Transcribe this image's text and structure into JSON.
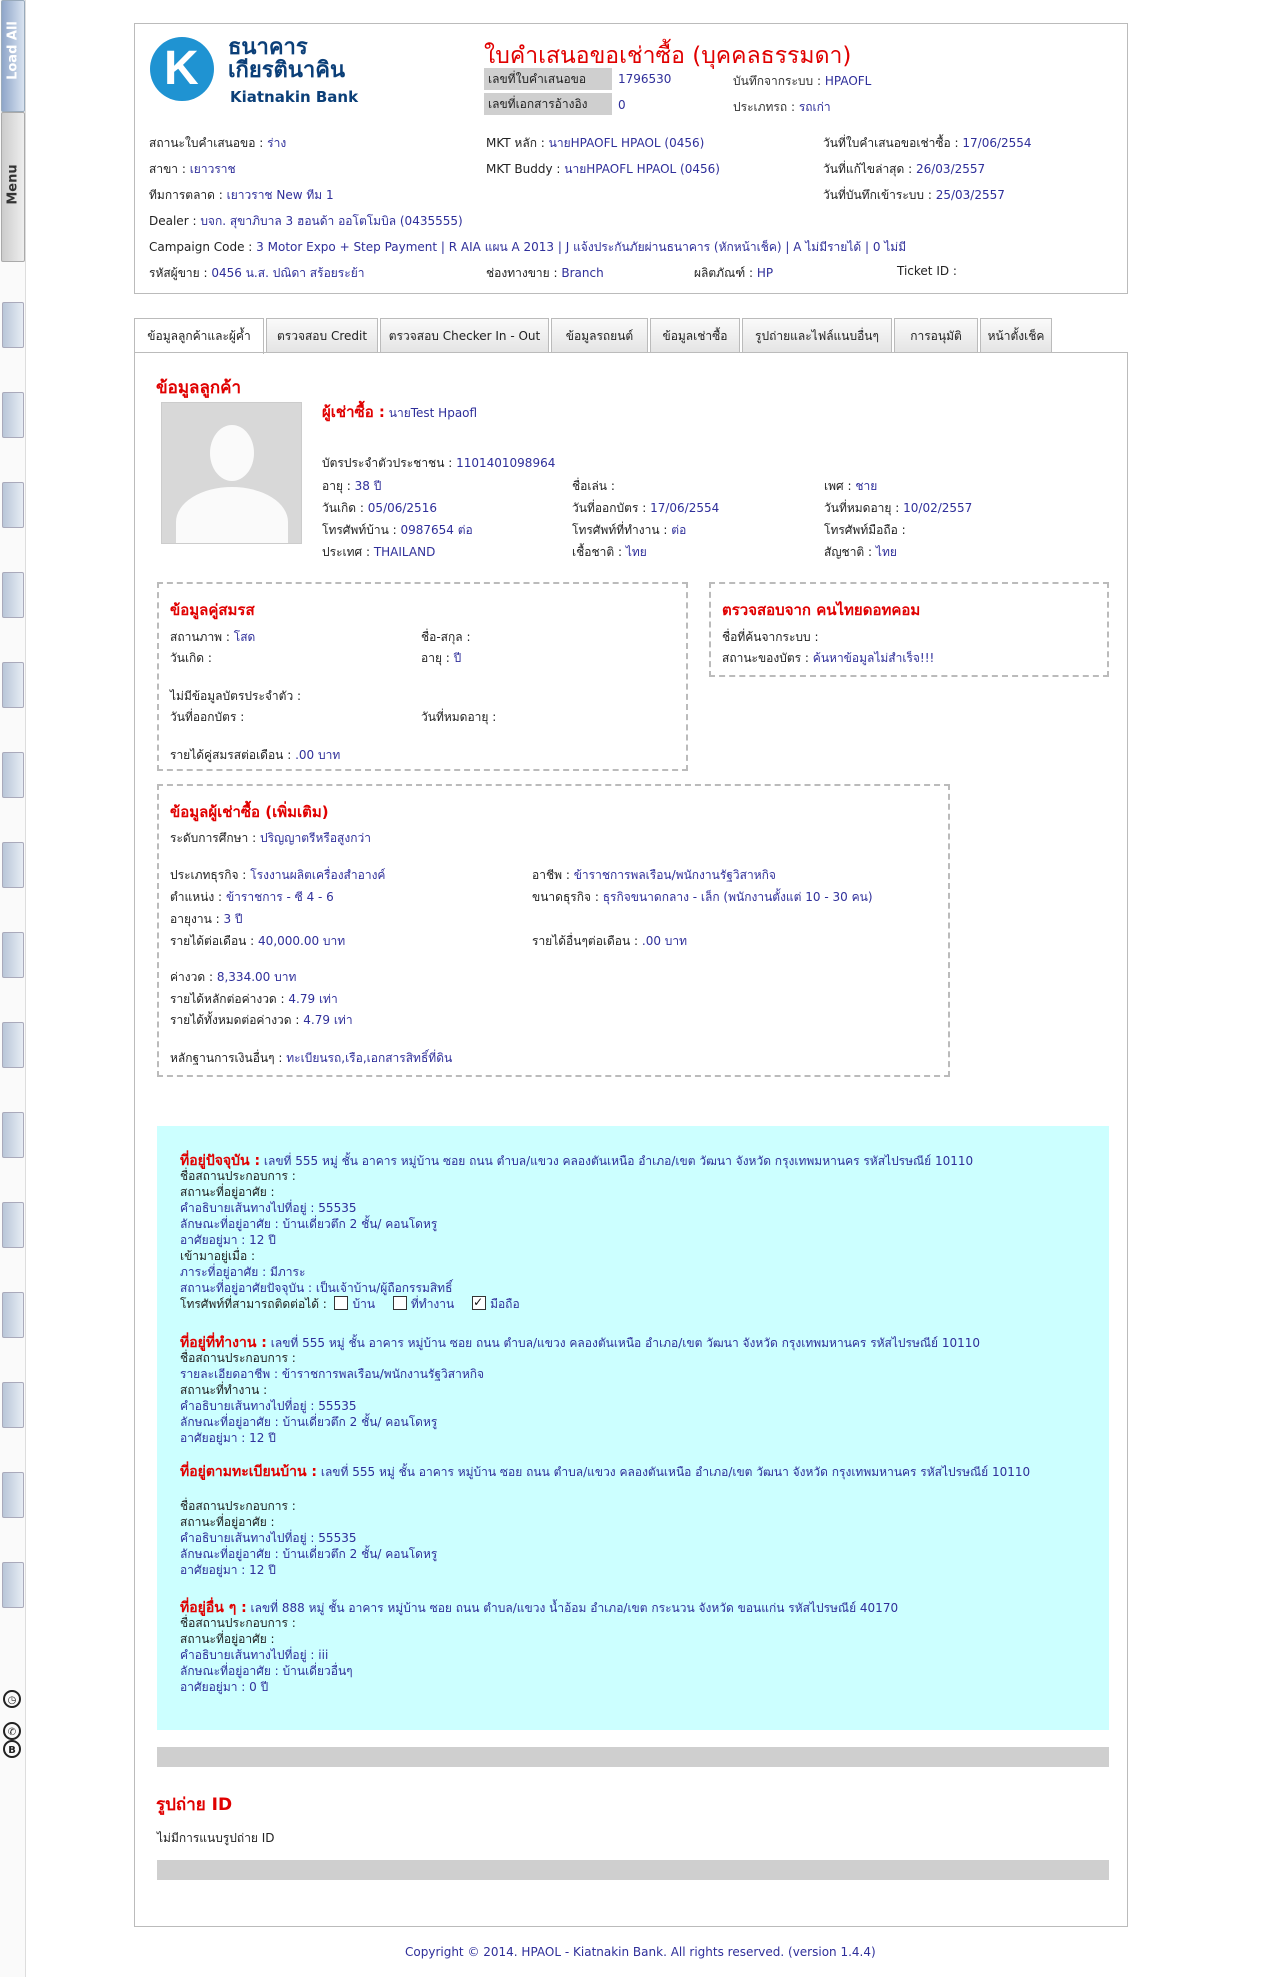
{
  "rail": {
    "load_all": "Load All",
    "menu": "Menu"
  },
  "header": {
    "bank_name_th": "ธนาคาร\nเกียรตินาคิน",
    "bank_name_en": "Kiatnakin Bank",
    "form_title": "ใบคำเสนอขอเช่าซื้อ (บุคคลธรรมดา)",
    "app_no_label": "เลขที่ใบคำเสนอขอ",
    "app_no": "1796530",
    "ref_doc_label": "เลขที่เอกสารอ้างอิง",
    "ref_doc": "0",
    "recorded_from_label": "บันทึกจากระบบ :",
    "recorded_from": "HPAOFL",
    "type_label": "ประเภทรถ :",
    "type": "รถเก่า",
    "status_label": "สถานะใบคำเสนอขอ :",
    "status": "ร่าง",
    "branch_label": "สาขา :",
    "branch": "เยาวราช",
    "team_label": "ทีมการตลาด :",
    "team": "เยาวราช New ทีม 1",
    "dealer_label": "Dealer :",
    "dealer": "บจก. สุขาภิบาล 3 ฮอนด้า ออโตโมบิล (0435555)",
    "campaign_label": "Campaign Code :",
    "campaign": "3 Motor Expo + Step Payment | R AIA แผน A 2013 | J แจ้งประกันภัยผ่านธนาคาร (หักหน้าเช็ค) | A ไม่มีรายได้ | 0 ไม่มี",
    "seller_label": "รหัสผู้ขาย :",
    "seller": "0456 น.ส. ปณิดา สร้อยระย้า",
    "mkt_main_label": "MKT หลัก :",
    "mkt_main": "นายHPAOFL HPAOL (0456)",
    "mkt_buddy_label": "MKT Buddy :",
    "mkt_buddy": "นายHPAOFL HPAOL (0456)",
    "channel_label": "ช่องทางขาย :",
    "channel": "Branch",
    "product_label": "ผลิตภัณฑ์ :",
    "product": "HP",
    "ticket_label": "Ticket ID :",
    "ticket": "",
    "app_date_label": "วันที่ใบคำเสนอขอเช่าซื้อ :",
    "app_date": "17/06/2554",
    "last_edit_label": "วันที่แก้ไขล่าสุด :",
    "last_edit": "26/03/2557",
    "entry_date_label": "วันที่บันทึกเข้าระบบ :",
    "entry_date": "25/03/2557"
  },
  "tabs": [
    "ข้อมูลลูกค้าและผู้ค้ำ",
    "ตรวจสอบ Credit",
    "ตรวจสอบ Checker In - Out",
    "ข้อมูลรถยนต์",
    "ข้อมูลเช่าซื้อ",
    "รูปถ่ายและไฟล์แนบอื่นๆ",
    "การอนุมัติ",
    "หน้าตั้งเช็ค"
  ],
  "customer": {
    "section_title": "ข้อมูลลูกค้า",
    "hirer_label": "ผู้เช่าซื้อ :",
    "hirer": "นายTest Hpaofl",
    "id_label": "บัตรประจำตัวประชาชน :",
    "id": "1101401098964",
    "age_label": "อายุ :",
    "age": "38 ปี",
    "nick_label": "ชื่อเล่น :",
    "nick": "",
    "sex_label": "เพศ :",
    "sex": "ชาย",
    "dob_label": "วันเกิด :",
    "dob": "05/06/2516",
    "issue_label": "วันที่ออกบัตร :",
    "issue": "17/06/2554",
    "expire_label": "วันที่หมดอายุ :",
    "expire": "10/02/2557",
    "home_tel_label": "โทรศัพท์บ้าน :",
    "home_tel": "0987654 ต่อ",
    "work_tel_label": "โทรศัพท์ที่ทำงาน :",
    "work_tel": "ต่อ",
    "mobile_label": "โทรศัพท์มือถือ :",
    "mobile": "",
    "country_label": "ประเทศ :",
    "country": "THAILAND",
    "race_label": "เชื้อชาติ :",
    "race": "ไทย",
    "nation_label": "สัญชาติ :",
    "nation": "ไทย"
  },
  "spouse": {
    "title": "ข้อมูลคู่สมรส",
    "status_label": "สถานภาพ :",
    "status": "โสด",
    "name_label": "ชื่อ-สกุล :",
    "name": "",
    "dob_label": "วันเกิด :",
    "dob": "",
    "age_label": "อายุ :",
    "age": "ปี",
    "noid_label": "ไม่มีข้อมูลบัตรประจำตัว :",
    "issue_label": "วันที่ออกบัตร :",
    "expire_label": "วันที่หมดอายุ :",
    "income_label": "รายได้คู่สมรสต่อเดือน :",
    "income": ".00 บาท"
  },
  "check": {
    "title": "ตรวจสอบจาก คนไทยดอทคอม",
    "name_label": "ชื่อที่ค้นจากระบบ :",
    "name": "",
    "card_label": "สถานะของบัตร :",
    "card": "ค้นหาข้อมูลไม่สำเร็จ!!!"
  },
  "extra": {
    "title": "ข้อมูลผู้เช่าซื้อ (เพิ่มเติม)",
    "edu_label": "ระดับการศึกษา :",
    "edu": "ปริญญาตรีหรือสูงกว่า",
    "biz_label": "ประเภทธุรกิจ :",
    "biz": "โรงงานผลิตเครื่องสำอางค์",
    "job_label": "อาชีพ :",
    "job": "ข้าราชการพลเรือน/พนักงานรัฐวิสาหกิจ",
    "pos_label": "ตำแหน่ง :",
    "pos": "ข้าราชการ - ซี 4 - 6",
    "size_label": "ขนาดธุรกิจ :",
    "size": "ธุรกิจขนาดกลาง - เล็ก (พนักงานตั้งแต่ 10 - 30 คน)",
    "tenure_label": "อายุงาน :",
    "tenure": "3 ปี",
    "income_label": "รายได้ต่อเดือน :",
    "income": "40,000.00 บาท",
    "other_label": "รายได้อื่นๆต่อเดือน :",
    "other": ".00 บาท",
    "install_label": "ค่างวด :",
    "install": "8,334.00 บาท",
    "ratio1_label": "รายได้หลักต่อค่างวด :",
    "ratio1": "4.79 เท่า",
    "ratio2_label": "รายได้ทั้งหมดต่อค่างวด :",
    "ratio2": "4.79 เท่า",
    "proof_label": "หลักฐานการเงินอื่นๆ :",
    "proof": "ทะเบียนรถ,เรือ,เอกสารสิทธิ์ที่ดิน"
  },
  "addr": {
    "current_head": "ที่อยู่ปัจจุบัน :",
    "current_line": "เลขที่ 555 หมู่ ชั้น อาคาร หมู่บ้าน ซอย ถนน ตำบล/แขวง คลองตันเหนือ อำเภอ/เขต วัฒนา จังหวัด กรุงเทพมหานคร รหัสไปรษณีย์ 10110",
    "current_rows": [
      "ชื่อสถานประกอบการ :",
      "สถานะที่อยู่อาศัย :",
      "คำอธิบายเส้นทางไปที่อยู่ : 55535",
      "ลักษณะที่อยู่อาศัย : บ้านเดี่ยวตึก 2 ชั้น/ คอนโดหรู",
      "อาศัยอยู่มา : 12 ปี",
      "เข้ามาอยู่เมื่อ :",
      "ภาระที่อยู่อาศัย : มีภาระ",
      "สถานะที่อยู่อาศัยปัจจุบัน : เป็นเจ้าบ้าน/ผู้ถือกรรมสิทธิ์"
    ],
    "contact_label": "โทรศัพท์ที่สามารถติดต่อได้ :",
    "contact_home": "บ้าน",
    "contact_work": "ที่ทำงาน",
    "contact_mobile": "มือถือ",
    "work_head": "ที่อยู่ที่ทำงาน :",
    "work_line": "เลขที่ 555 หมู่ ชั้น อาคาร หมู่บ้าน ซอย ถนน ตำบล/แขวง คลองตันเหนือ อำเภอ/เขต วัฒนา จังหวัด กรุงเทพมหานคร รหัสไปรษณีย์ 10110",
    "work_rows": [
      "ชื่อสถานประกอบการ :",
      "รายละเอียดอาชีพ : ข้าราชการพลเรือน/พนักงานรัฐวิสาหกิจ",
      "สถานะที่ทำงาน :",
      "คำอธิบายเส้นทางไปที่อยู่ : 55535",
      "ลักษณะที่อยู่อาศัย : บ้านเดี่ยวตึก 2 ชั้น/ คอนโดหรู",
      "อาศัยอยู่มา : 12 ปี"
    ],
    "reg_head": "ที่อยู่ตามทะเบียนบ้าน :",
    "reg_line": "เลขที่ 555 หมู่ ชั้น อาคาร หมู่บ้าน ซอย ถนน ตำบล/แขวง คลองตันเหนือ อำเภอ/เขต วัฒนา จังหวัด กรุงเทพมหานคร รหัสไปรษณีย์ 10110",
    "reg_rows": [
      "ชื่อสถานประกอบการ :",
      "สถานะที่อยู่อาศัย :",
      "คำอธิบายเส้นทางไปที่อยู่ : 55535",
      "ลักษณะที่อยู่อาศัย : บ้านเดี่ยวตึก 2 ชั้น/ คอนโดหรู",
      "อาศัยอยู่มา : 12 ปี"
    ],
    "other_head": "ที่อยู่อื่น ๆ :",
    "other_line": "เลขที่ 888 หมู่ ชั้น อาคาร หมู่บ้าน ซอย ถนน ตำบล/แขวง น้ำอ้อม อำเภอ/เขต กระนวน จังหวัด ขอนแก่น รหัสไปรษณีย์ 40170",
    "other_rows": [
      "ชื่อสถานประกอบการ :",
      "สถานะที่อยู่อาศัย :",
      "คำอธิบายเส้นทางไปที่อยู่ : iii",
      "ลักษณะที่อยู่อาศัย : บ้านเดี่ยวอื่นๆ",
      "อาศัยอยู่มา : 0 ปี"
    ]
  },
  "photo_id": {
    "title": "รูปถ่าย ID",
    "none": "ไม่มีการแนบรูปถ่าย ID"
  },
  "footer": "Copyright © 2014. HPAOL - Kiatnakin Bank. All rights reserved. (version 1.4.4)"
}
